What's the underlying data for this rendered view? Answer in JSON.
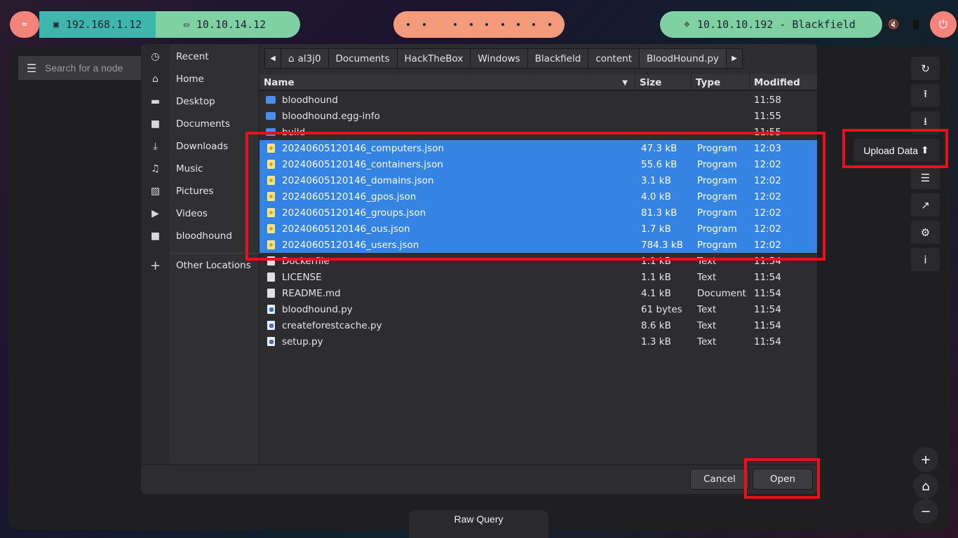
{
  "topbar": {
    "host_ip": "192.168.1.12",
    "vpn_ip": "10.10.14.12",
    "target": "10.10.10.192 - Blackfield",
    "workspaces": 10,
    "active_workspace_index": 2
  },
  "app": {
    "search_placeholder": "Search for a node",
    "upload_tooltip": "Upload Data",
    "raw_query_label": "Raw Query"
  },
  "dialog": {
    "places": [
      {
        "label": "Recent",
        "icon": "clock-icon"
      },
      {
        "label": "Home",
        "icon": "home-icon"
      },
      {
        "label": "Desktop",
        "icon": "desktop-icon"
      },
      {
        "label": "Documents",
        "icon": "document-icon"
      },
      {
        "label": "Downloads",
        "icon": "download-icon"
      },
      {
        "label": "Music",
        "icon": "music-icon"
      },
      {
        "label": "Pictures",
        "icon": "picture-icon"
      },
      {
        "label": "Videos",
        "icon": "video-icon"
      },
      {
        "label": "bloodhound",
        "icon": "folder-icon"
      },
      {
        "label": "Other Locations",
        "icon": "plus-icon"
      }
    ],
    "path": [
      "al3j0",
      "Documents",
      "HackTheBox",
      "Windows",
      "Blackfield",
      "content",
      "BloodHound.py"
    ],
    "columns": {
      "name": "Name",
      "size": "Size",
      "type": "Type",
      "modified": "Modified"
    },
    "files": [
      {
        "name": "bloodhound",
        "size": "",
        "type": "",
        "modified": "11:58",
        "kind": "folder",
        "selected": false
      },
      {
        "name": "bloodhound.egg-info",
        "size": "",
        "type": "",
        "modified": "11:55",
        "kind": "folder",
        "selected": false
      },
      {
        "name": "build",
        "size": "",
        "type": "",
        "modified": "11:55",
        "kind": "folder",
        "selected": false
      },
      {
        "name": "20240605120146_computers.json",
        "size": "47.3 kB",
        "type": "Program",
        "modified": "12:03",
        "kind": "json",
        "selected": true
      },
      {
        "name": "20240605120146_containers.json",
        "size": "55.6 kB",
        "type": "Program",
        "modified": "12:02",
        "kind": "json",
        "selected": true
      },
      {
        "name": "20240605120146_domains.json",
        "size": "3.1 kB",
        "type": "Program",
        "modified": "12:02",
        "kind": "json",
        "selected": true
      },
      {
        "name": "20240605120146_gpos.json",
        "size": "4.0 kB",
        "type": "Program",
        "modified": "12:02",
        "kind": "json",
        "selected": true
      },
      {
        "name": "20240605120146_groups.json",
        "size": "81.3 kB",
        "type": "Program",
        "modified": "12:02",
        "kind": "json",
        "selected": true
      },
      {
        "name": "20240605120146_ous.json",
        "size": "1.7 kB",
        "type": "Program",
        "modified": "12:02",
        "kind": "json",
        "selected": true
      },
      {
        "name": "20240605120146_users.json",
        "size": "784.3 kB",
        "type": "Program",
        "modified": "12:02",
        "kind": "json",
        "selected": true
      },
      {
        "name": "Dockerfile",
        "size": "1.1 kB",
        "type": "Text",
        "modified": "11:54",
        "kind": "text",
        "selected": false
      },
      {
        "name": "LICENSE",
        "size": "1.1 kB",
        "type": "Text",
        "modified": "11:54",
        "kind": "text",
        "selected": false
      },
      {
        "name": "README.md",
        "size": "4.1 kB",
        "type": "Document",
        "modified": "11:54",
        "kind": "text",
        "selected": false
      },
      {
        "name": "bloodhound.py",
        "size": "61 bytes",
        "type": "Text",
        "modified": "11:54",
        "kind": "py",
        "selected": false
      },
      {
        "name": "createforestcache.py",
        "size": "8.6 kB",
        "type": "Text",
        "modified": "11:54",
        "kind": "py",
        "selected": false
      },
      {
        "name": "setup.py",
        "size": "1.3 kB",
        "type": "Text",
        "modified": "11:54",
        "kind": "py",
        "selected": false
      }
    ],
    "cancel_label": "Cancel",
    "open_label": "Open"
  },
  "colors": {
    "selection": "#3584e4",
    "highlight_box": "#e8111b"
  }
}
